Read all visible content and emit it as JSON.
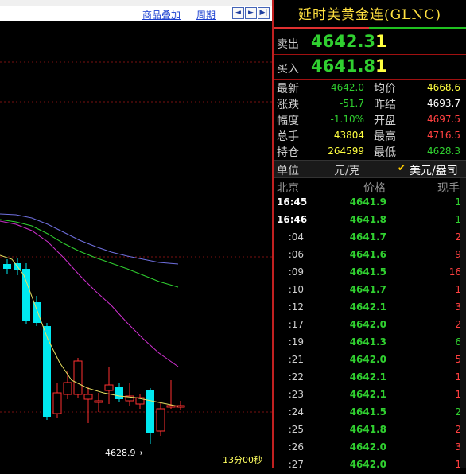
{
  "toolbar": {
    "overlay_label": "商品叠加",
    "period_label": "周期",
    "prev_icon": "arrow-left-icon",
    "next_icon": "arrow-right-icon",
    "end_icon": "skip-end-icon"
  },
  "chart": {
    "low_marker": "4628.9→",
    "time_readout": "13分00秒",
    "colors": {
      "up_candle": "#ff3030",
      "down_candle": "#00e8f0",
      "ma_yellow": "#e8e060",
      "ma_magenta": "#d030d0",
      "ma_green": "#30d030",
      "ma_blue": "#7070e0",
      "grid": "#7a1010"
    }
  },
  "quote": {
    "title": "延时美黄金连(GLNC)",
    "sell": {
      "label": "卖出",
      "price": "4642.3",
      "volume": "1"
    },
    "buy": {
      "label": "买入",
      "price": "4641.8",
      "volume": "1"
    },
    "stats": [
      {
        "l1": "最新",
        "v1": "4642.0",
        "c1": "#30d030",
        "l2": "均价",
        "v2": "4668.6",
        "c2": "#ffff40"
      },
      {
        "l1": "涨跌",
        "v1": "-51.7",
        "c1": "#30d030",
        "l2": "昨结",
        "v2": "4693.7",
        "c2": "#ffffff"
      },
      {
        "l1": "幅度",
        "v1": "-1.10%",
        "c1": "#30d030",
        "l2": "开盘",
        "v2": "4697.5",
        "c2": "#ff4040"
      },
      {
        "l1": "总手",
        "v1": "43804",
        "c1": "#ffff40",
        "l2": "最高",
        "v2": "4716.5",
        "c2": "#ff4040"
      },
      {
        "l1": "持仓",
        "v1": "264599",
        "c1": "#ffff40",
        "l2": "最低",
        "v2": "4628.3",
        "c2": "#30d030"
      }
    ],
    "unit": {
      "label": "单位",
      "value": "元/克",
      "check": "✔",
      "alt": "美元/盎司"
    },
    "tick_header": {
      "time": "北京",
      "price": "价格",
      "volume": "现手"
    },
    "ticks": [
      {
        "time": "16:45",
        "price": "4641.9",
        "volume": "1",
        "vcolor": "#30d030",
        "bold": true
      },
      {
        "time": "16:46",
        "price": "4641.8",
        "volume": "1",
        "vcolor": "#30d030",
        "bold": true
      },
      {
        "time": ":04",
        "price": "4641.7",
        "volume": "2",
        "vcolor": "#ff4040",
        "bold": false
      },
      {
        "time": ":06",
        "price": "4641.6",
        "volume": "9",
        "vcolor": "#ff4040",
        "bold": false
      },
      {
        "time": ":09",
        "price": "4641.5",
        "volume": "16",
        "vcolor": "#ff4040",
        "bold": false
      },
      {
        "time": ":10",
        "price": "4641.7",
        "volume": "1",
        "vcolor": "#ff4040",
        "bold": false
      },
      {
        "time": ":12",
        "price": "4642.1",
        "volume": "3",
        "vcolor": "#ff4040",
        "bold": false
      },
      {
        "time": ":17",
        "price": "4642.0",
        "volume": "2",
        "vcolor": "#ff4040",
        "bold": false
      },
      {
        "time": ":19",
        "price": "4641.3",
        "volume": "6",
        "vcolor": "#30d030",
        "bold": false
      },
      {
        "time": ":21",
        "price": "4642.0",
        "volume": "5",
        "vcolor": "#ff4040",
        "bold": false
      },
      {
        "time": ":22",
        "price": "4642.1",
        "volume": "1",
        "vcolor": "#ff4040",
        "bold": false
      },
      {
        "time": ":23",
        "price": "4642.1",
        "volume": "1",
        "vcolor": "#ff4040",
        "bold": false
      },
      {
        "time": ":24",
        "price": "4641.5",
        "volume": "2",
        "vcolor": "#30d030",
        "bold": false
      },
      {
        "time": ":25",
        "price": "4641.8",
        "volume": "2",
        "vcolor": "#ff4040",
        "bold": false
      },
      {
        "time": ":26",
        "price": "4642.0",
        "volume": "3",
        "vcolor": "#ff4040",
        "bold": false
      },
      {
        "time": ":27",
        "price": "4642.0",
        "volume": "1",
        "vcolor": "#ff4040",
        "bold": false
      }
    ]
  }
}
